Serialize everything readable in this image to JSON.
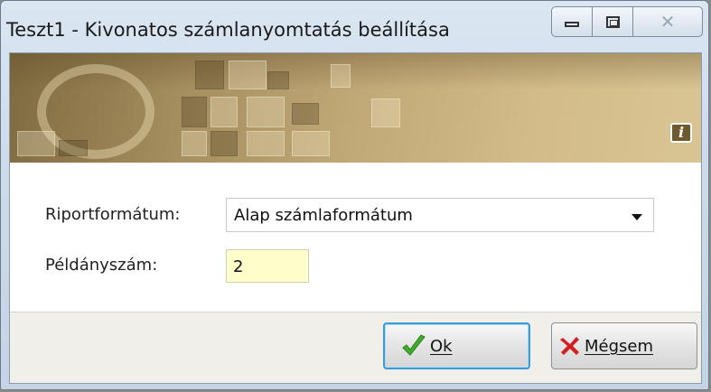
{
  "window": {
    "title": "Teszt1 - Kivonatos számlanyomtatás beállítása"
  },
  "caption_buttons": {
    "minimize_icon": "minimize-icon",
    "maximize_icon": "maximize-icon",
    "close_icon": "close-icon"
  },
  "banner": {
    "info_glyph": "i"
  },
  "form": {
    "report_format_label": "Riportformátum:",
    "report_format_value": "Alap számlaformátum",
    "copies_label": "Példányszám:",
    "copies_value": "2"
  },
  "buttons": {
    "ok_label": "Ok",
    "cancel_label": "Mégsem"
  },
  "colors": {
    "ok_check": "#3fae2a",
    "cancel_x": "#d21f1f",
    "copies_bg": "#ffffcc",
    "focus_border": "#3c9bd6"
  }
}
